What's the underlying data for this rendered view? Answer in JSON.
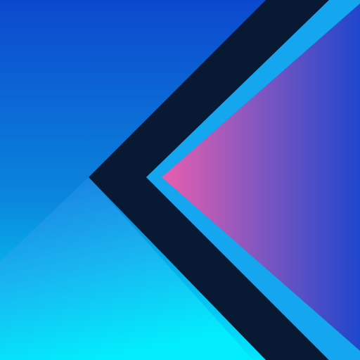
{
  "icon": {
    "name": "k-chevron-logo",
    "colors": {
      "navy": "#081a33",
      "stripe": "#14a6ee",
      "pink": "#e35fae",
      "violet": "#7a57c0",
      "royal_blue": "#1f46cc",
      "cyan": "#04e6fc",
      "blue_top": "#0c48cd",
      "sky": "#21aaed"
    }
  }
}
